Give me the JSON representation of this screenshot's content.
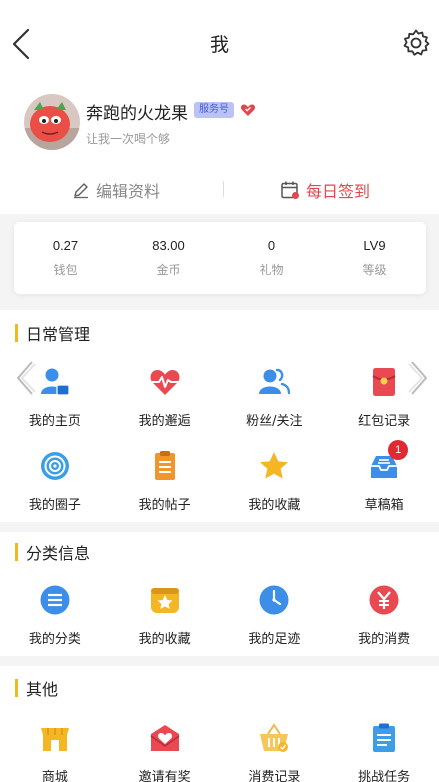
{
  "header": {
    "title": "我"
  },
  "profile": {
    "nickname": "奔跑的火龙果",
    "badge": "服务号",
    "signature": "让我一次喝个够",
    "edit_label": "编辑资料",
    "sign_label": "每日签到"
  },
  "stats": [
    {
      "value": "0.27",
      "label": "钱包"
    },
    {
      "value": "83.00",
      "label": "金币"
    },
    {
      "value": "0",
      "label": "礼物"
    },
    {
      "value": "LV9",
      "label": "等级"
    }
  ],
  "daily": {
    "title": "日常管理",
    "items": [
      {
        "label": "我的主页",
        "icon": "user-card-icon"
      },
      {
        "label": "我的邂逅",
        "icon": "heart-pulse-icon"
      },
      {
        "label": "粉丝/关注",
        "icon": "users-icon"
      },
      {
        "label": "红包记录",
        "icon": "red-envelope-icon"
      },
      {
        "label": "我的圈子",
        "icon": "circle-target-icon"
      },
      {
        "label": "我的帖子",
        "icon": "post-list-icon"
      },
      {
        "label": "我的收藏",
        "icon": "star-icon"
      },
      {
        "label": "草稿箱",
        "icon": "inbox-icon",
        "badge": "1"
      }
    ]
  },
  "category": {
    "title": "分类信息",
    "items": [
      {
        "label": "我的分类",
        "icon": "list-circle-icon"
      },
      {
        "label": "我的收藏",
        "icon": "star-box-icon"
      },
      {
        "label": "我的足迹",
        "icon": "clock-icon"
      },
      {
        "label": "我的消费",
        "icon": "yen-icon"
      }
    ]
  },
  "other": {
    "title": "其他",
    "items": [
      {
        "label": "商城",
        "icon": "shop-icon"
      },
      {
        "label": "邀请有奖",
        "icon": "envelope-heart-icon"
      },
      {
        "label": "消费记录",
        "icon": "basket-icon"
      },
      {
        "label": "挑战任务",
        "icon": "clipboard-icon"
      }
    ]
  },
  "colors": {
    "accent": "#f2b91e",
    "red": "#e0484f",
    "blue": "#3d8ee8",
    "orange": "#f0962a"
  }
}
